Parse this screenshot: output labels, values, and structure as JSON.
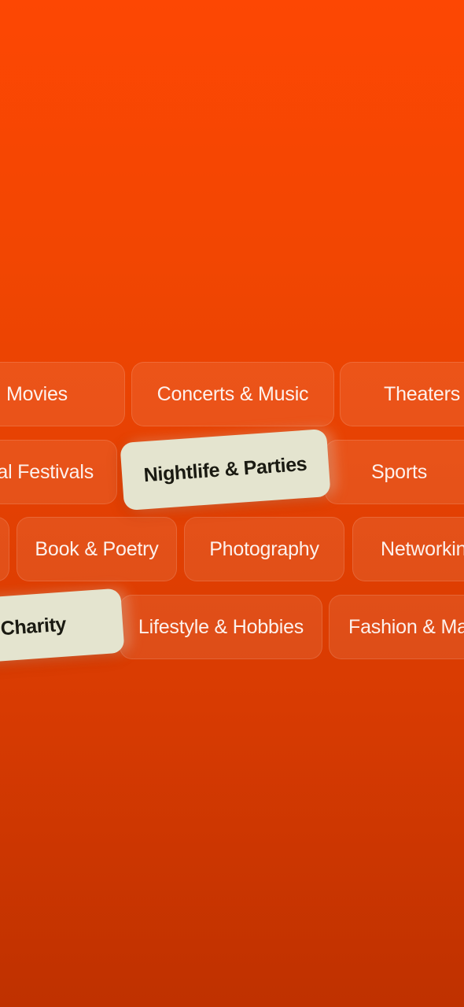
{
  "categories": {
    "row1": [
      "Movies",
      "Concerts & Music",
      "Theaters"
    ],
    "row2": [
      "al Festivals",
      "Nightlife & Parties",
      "Sports"
    ],
    "row3": [
      "Book & Poetry",
      "Photography",
      "Networkin"
    ],
    "row4": [
      "Charity",
      "Lifestyle & Hobbies",
      "Fashion & Ma"
    ]
  },
  "selected": [
    "Nightlife & Parties",
    "Charity"
  ],
  "colors": {
    "background_top": "#fd4703",
    "background_bottom": "#bf3100",
    "selected_chip": "#e4e4cf",
    "selected_text": "#1a1a12",
    "chip_text": "#ffffff"
  }
}
